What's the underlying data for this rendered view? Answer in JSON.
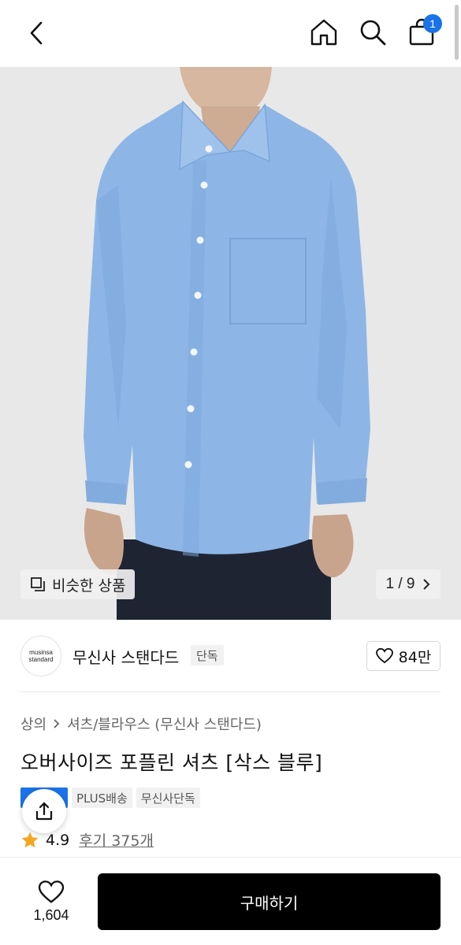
{
  "header": {
    "back_icon": "chevron-left-icon",
    "home_icon": "home-icon",
    "search_icon": "search-icon",
    "cart_icon": "shopping-bag-icon",
    "cart_count": "1",
    "badge_color": "#1a73e8"
  },
  "gallery": {
    "similar_button_label": "비슷한 상품",
    "counter": "1 / 9",
    "shirt_color": "#8db6e6"
  },
  "brand": {
    "logo_line1": "musinsa",
    "logo_line2": "standard",
    "name": "무신사 스탠다드",
    "tag": "단독",
    "likes": "84만"
  },
  "product": {
    "breadcrumb": [
      "상의",
      "셔츠/블라우스 (무신사 스탠다드)"
    ],
    "title": "오버사이즈 포플린 셔츠 [삭스 블루]",
    "badges": [
      "PLUS배송",
      "무신사단독"
    ],
    "rating": "4.9",
    "reviews": "후기 375개",
    "star_color": "#f5a623"
  },
  "bottom": {
    "wish_count": "1,604",
    "buy_label": "구매하기"
  }
}
